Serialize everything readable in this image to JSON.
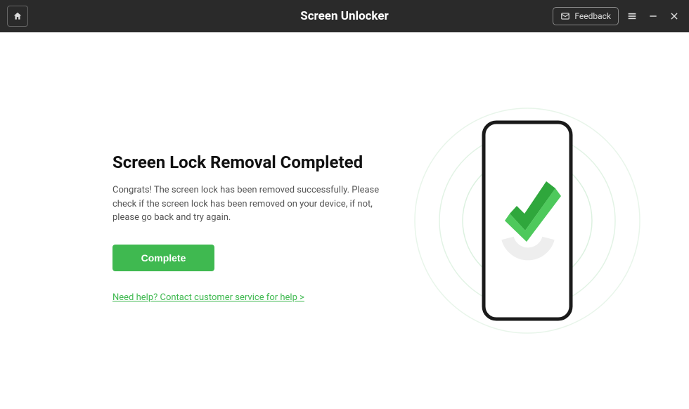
{
  "header": {
    "title": "Screen Unlocker",
    "feedback_label": "Feedback"
  },
  "main": {
    "heading": "Screen Lock Removal Completed",
    "body": "Congrats! The screen lock has been removed successfully. Please check if the screen lock has been removed on your device, if not, please go back and try again.",
    "complete_button": "Complete",
    "help_link": "Need help? Contact customer service for help >"
  },
  "colors": {
    "accent": "#3fb950"
  }
}
